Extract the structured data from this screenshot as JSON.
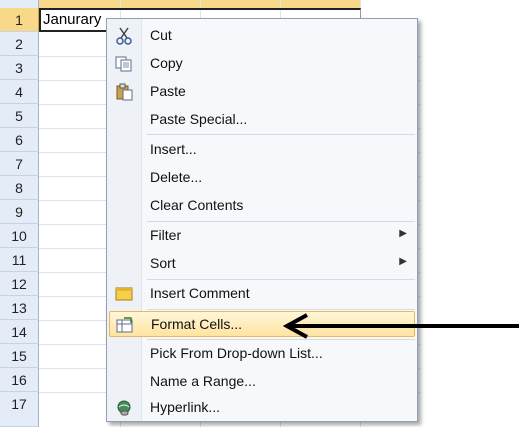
{
  "rows": [
    "1",
    "2",
    "3",
    "4",
    "5",
    "6",
    "7",
    "8",
    "9",
    "10",
    "11",
    "12",
    "13",
    "14",
    "15",
    "16",
    "17"
  ],
  "cell_a1": "Janurary",
  "menu": {
    "items": [
      {
        "label": "Cut",
        "icon": "scissors-icon"
      },
      {
        "label": "Copy",
        "icon": "copy-icon"
      },
      {
        "label": "Paste",
        "icon": "paste-icon"
      },
      {
        "label": "Paste Special...",
        "icon": ""
      },
      {
        "label": "Insert...",
        "icon": ""
      },
      {
        "label": "Delete...",
        "icon": ""
      },
      {
        "label": "Clear Contents",
        "icon": ""
      },
      {
        "label": "Filter",
        "icon": "",
        "submenu": true
      },
      {
        "label": "Sort",
        "icon": "",
        "submenu": true
      },
      {
        "label": "Insert Comment",
        "icon": "comment-icon"
      },
      {
        "label": "Format Cells...",
        "icon": "format-cells-icon",
        "highlighted": true
      },
      {
        "label": "Pick From Drop-down List...",
        "icon": ""
      },
      {
        "label": "Name a Range...",
        "icon": ""
      },
      {
        "label": "Hyperlink...",
        "icon": "hyperlink-icon"
      }
    ]
  }
}
